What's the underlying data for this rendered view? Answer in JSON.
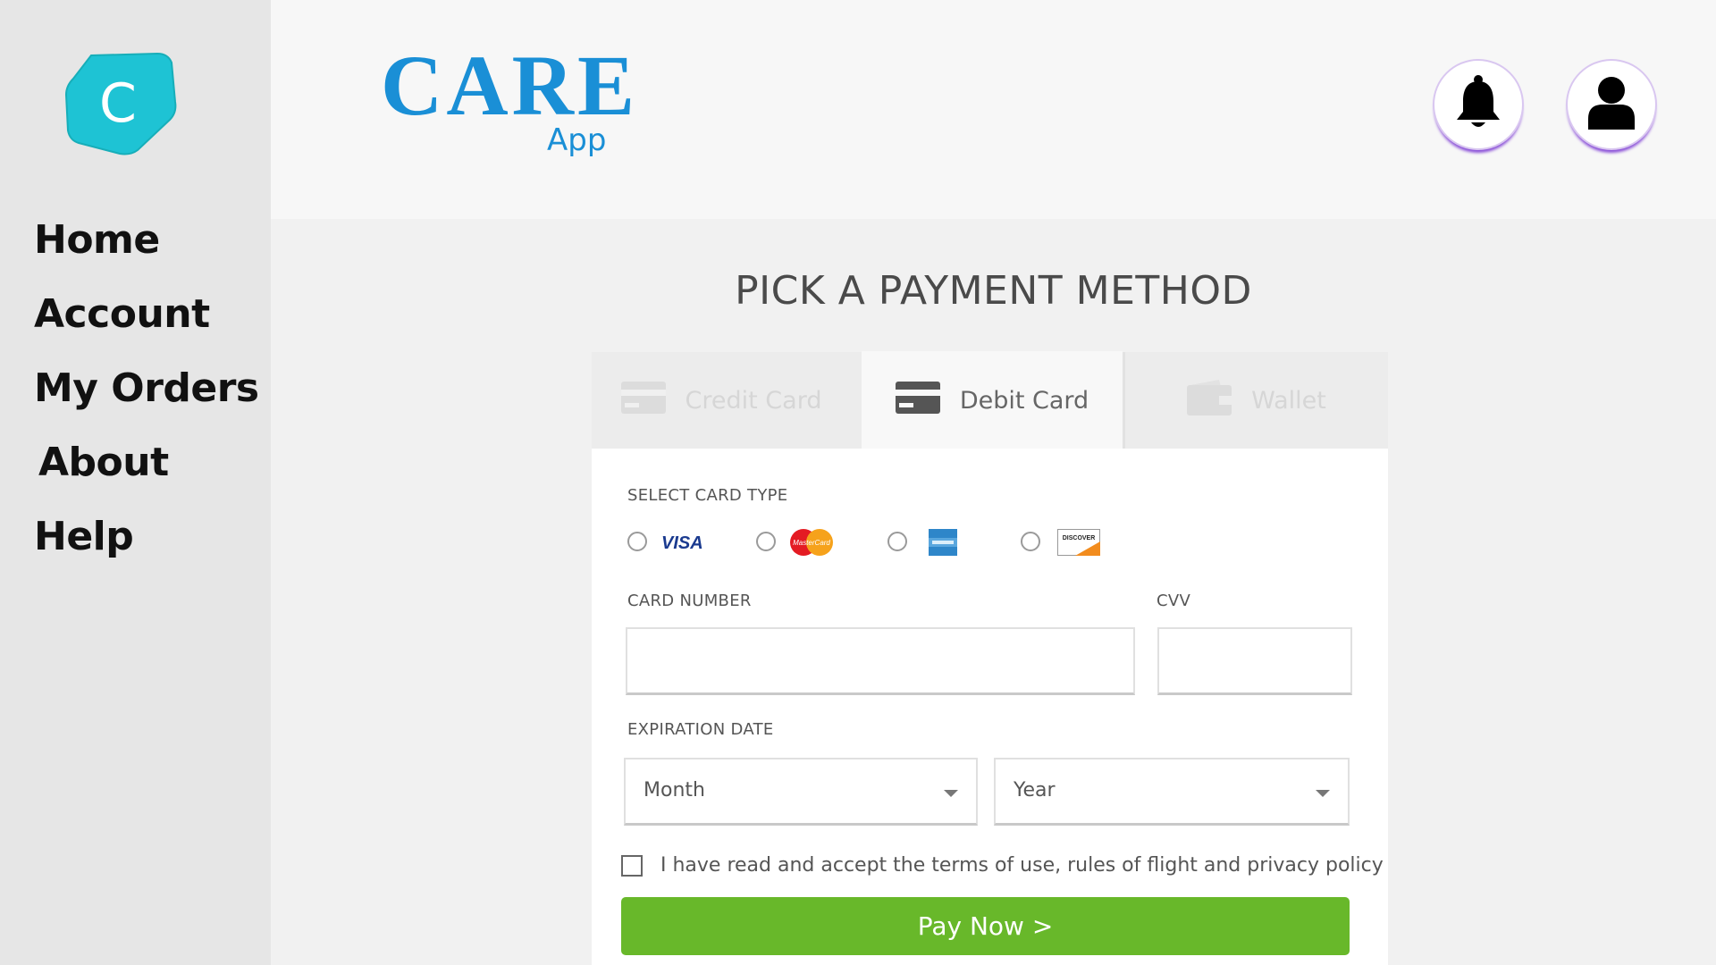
{
  "sidebar": {
    "logo_letter": "C",
    "logo_color": "#1ec3d4",
    "items": [
      {
        "label": "Home"
      },
      {
        "label": "Account"
      },
      {
        "label": "My Orders"
      },
      {
        "label": "About"
      },
      {
        "label": "Help"
      }
    ]
  },
  "header": {
    "brand": "CARE",
    "brand_sub": "App",
    "brand_color": "#1a8fd6",
    "icons": [
      "bell-icon",
      "user-icon"
    ]
  },
  "main": {
    "title": "PICK A PAYMENT METHOD",
    "tabs": [
      {
        "label": "Credit Card",
        "active": false
      },
      {
        "label": "Debit Card",
        "active": true
      },
      {
        "label": "Wallet",
        "active": false
      }
    ],
    "card_type_label": "SELECT CARD TYPE",
    "card_types": [
      {
        "name": "visa",
        "text": "VISA"
      },
      {
        "name": "mastercard",
        "text": "MasterCard"
      },
      {
        "name": "amex",
        "text": ""
      },
      {
        "name": "discover",
        "text": "DISCOVER"
      }
    ],
    "card_number_label": "CARD NUMBER",
    "card_number_value": "",
    "cvv_label": "CVV",
    "cvv_value": "",
    "expiration_label": "EXPIRATION DATE",
    "month_value": "Month",
    "year_value": "Year",
    "terms_text": "I have read and accept the terms of use, rules of flight and privacy policy",
    "terms_checked": false,
    "pay_button": "Pay Now >",
    "pay_color": "#68b82a"
  }
}
